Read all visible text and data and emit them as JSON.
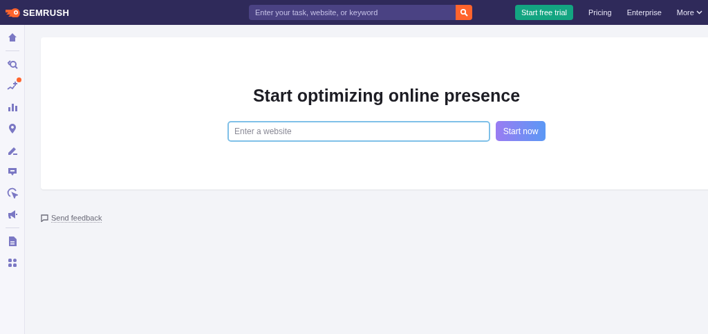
{
  "header": {
    "logo": "SEMRUSH",
    "search": {
      "placeholder": "Enter your task, website, or keyword"
    },
    "trial_button": "Start free trial",
    "nav": [
      {
        "label": "Pricing",
        "kind": "link"
      },
      {
        "label": "Enterprise",
        "kind": "link"
      },
      {
        "label": "More",
        "kind": "dropdown"
      }
    ]
  },
  "sidebar": {
    "groups": [
      [
        {
          "kind": "home",
          "notification": false
        }
      ],
      [
        {
          "kind": "seo",
          "notification": false
        },
        {
          "kind": "ai",
          "notification": true
        },
        {
          "kind": "chart",
          "notification": false
        },
        {
          "kind": "pin",
          "notification": false
        },
        {
          "kind": "pen",
          "notification": false
        },
        {
          "kind": "chat",
          "notification": false
        },
        {
          "kind": "cursor",
          "notification": false
        },
        {
          "kind": "megaphone",
          "notification": false
        }
      ],
      [
        {
          "kind": "doc",
          "notification": false
        },
        {
          "kind": "apps",
          "notification": false
        }
      ]
    ]
  },
  "main": {
    "title": "Start optimizing online presence",
    "field": {
      "placeholder": "Enter a website"
    },
    "button": "Start now",
    "feedback": "Send feedback"
  }
}
